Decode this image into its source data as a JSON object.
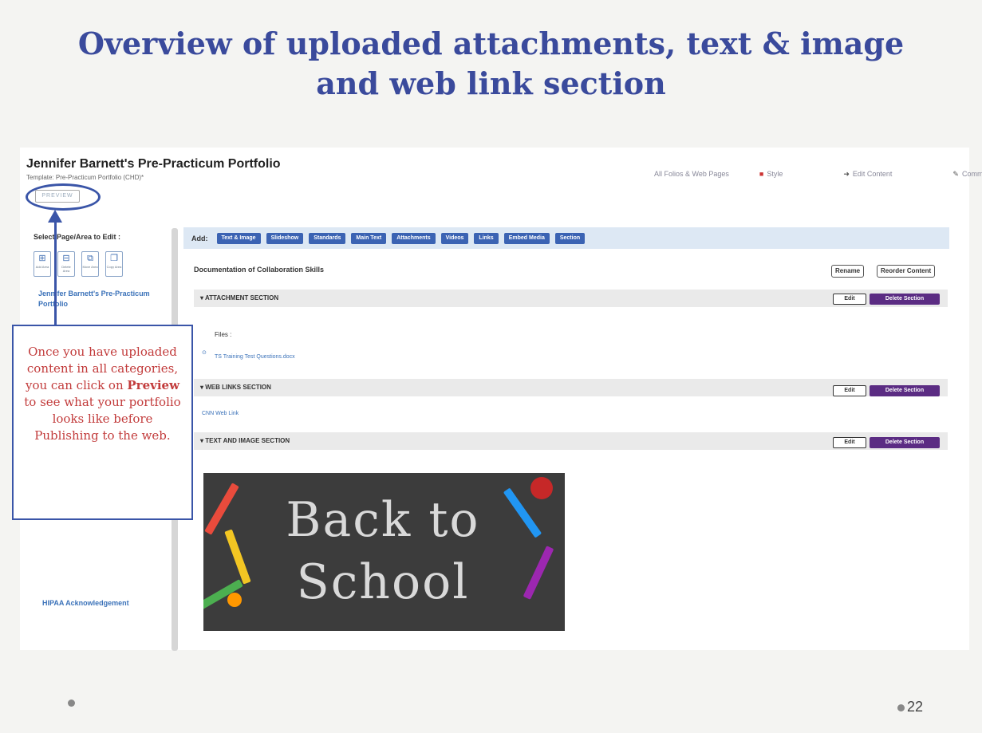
{
  "slide": {
    "title_line1": "Overview of uploaded attachments, text & image",
    "title_line2": "and web link section",
    "page_number": "22"
  },
  "app": {
    "portfolio_title": "Jennifer Barnett's Pre-Practicum Portfolio",
    "portfolio_subtitle": "Template: Pre-Practicum Portfolio (CHD)*",
    "preview_label": "PREVIEW",
    "topnav": {
      "all_folios": "All Folios & Web Pages",
      "style": "Style",
      "edit_content": "Edit Content",
      "comm": "Comm"
    },
    "sidebar": {
      "heading": "Select Page/Area to Edit :",
      "icons": [
        {
          "icon": "add-area-icon",
          "label": "Add Area"
        },
        {
          "icon": "delete-area-icon",
          "label": "Delete Area"
        },
        {
          "icon": "move-area-icon",
          "label": "Move Area"
        },
        {
          "icon": "copy-area-icon",
          "label": "Copy Area"
        }
      ],
      "current_page": "Jennifer Barnett's Pre-Practicum Portfolio",
      "hipaa": "HIPAA Acknowledgement"
    },
    "addbar": {
      "label": "Add:",
      "buttons": [
        "Text & Image",
        "Slideshow",
        "Standards",
        "Main Text",
        "Attachments",
        "Videos",
        "Links",
        "Embed Media",
        "Section"
      ]
    },
    "doc_title": "Documentation of Collaboration Skills",
    "rename_label": "Rename",
    "reorder_label": "Reorder Content",
    "sections": {
      "attachment": "ATTACHMENT SECTION",
      "weblinks": "WEB LINKS SECTION",
      "textimage": "TEXT AND IMAGE SECTION"
    },
    "edit_label": "Edit",
    "delete_label": "Delete Section",
    "files_label": "Files :",
    "file_name": "TS Training Test Questions.docx",
    "web_link": "CNN Web Link",
    "image_text_line1": "Back to",
    "image_text_line2": "School"
  },
  "callout": {
    "text_before": "Once you have uploaded content in all categories, you can click on",
    "emphasis": "Preview",
    "text_after": "to see what your portfolio looks like before Publishing to the web."
  },
  "colors": {
    "title_blue": "#3a4a9c",
    "callout_red": "#c23b3b",
    "button_blue": "#3b63b3",
    "delete_purple": "#5b2c83"
  }
}
